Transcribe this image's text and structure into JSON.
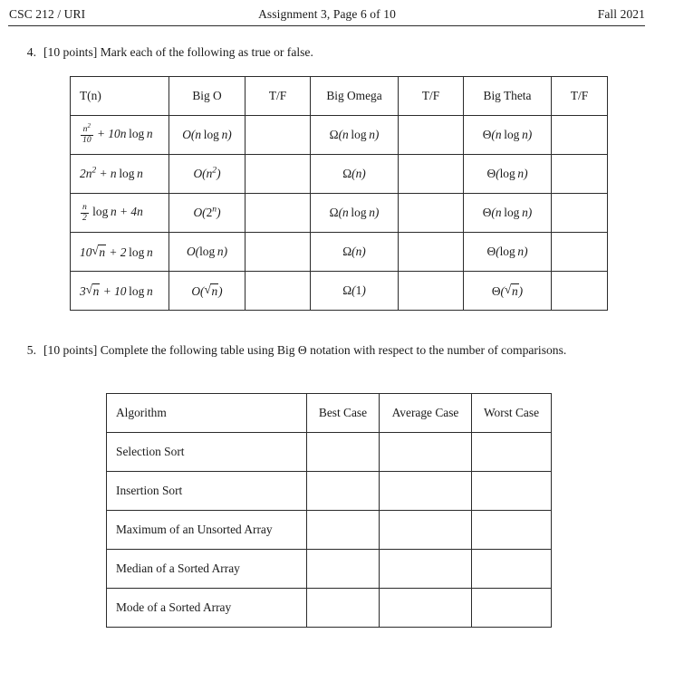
{
  "header": {
    "left": "CSC 212 / URI",
    "center": "Assignment 3, Page 6 of 10",
    "right": "Fall 2021"
  },
  "problems": [
    {
      "number": "4.",
      "points": "[10 points]",
      "text": "Mark each of the following as true or false."
    },
    {
      "number": "5.",
      "points": "[10 points]",
      "text": "Complete the following table using Big Θ notation with respect to the number of comparisons."
    }
  ],
  "table_truefalse": {
    "headers": [
      "T(n)",
      "Big O",
      "T/F",
      "Big Omega",
      "T/F",
      "Big Theta",
      "T/F"
    ],
    "rows": [
      {
        "tn": "n²/10 + 10n log n",
        "big_o": "O(n log n)",
        "tf1": "",
        "big_omega": "Ω(n log n)",
        "tf2": "",
        "big_theta": "Θ(n log n)",
        "tf3": ""
      },
      {
        "tn": "2n² + n log n",
        "big_o": "O(n²)",
        "tf1": "",
        "big_omega": "Ω(n)",
        "tf2": "",
        "big_theta": "Θ(log n)",
        "tf3": ""
      },
      {
        "tn": "n/2 log n + 4n",
        "big_o": "O(2ⁿ)",
        "tf1": "",
        "big_omega": "Ω(n log n)",
        "tf2": "",
        "big_theta": "Θ(n log n)",
        "tf3": ""
      },
      {
        "tn": "10√n + 2 log n",
        "big_o": "O(log n)",
        "tf1": "",
        "big_omega": "Ω(n)",
        "tf2": "",
        "big_theta": "Θ(log n)",
        "tf3": ""
      },
      {
        "tn": "3√n + 10 log n",
        "big_o": "O(√n)",
        "tf1": "",
        "big_omega": "Ω(1)",
        "tf2": "",
        "big_theta": "Θ(√n)",
        "tf3": ""
      }
    ]
  },
  "table_bigtheta": {
    "headers": [
      "Algorithm",
      "Best Case",
      "Average Case",
      "Worst Case"
    ],
    "rows": [
      {
        "algorithm": "Selection Sort",
        "best": "",
        "average": "",
        "worst": ""
      },
      {
        "algorithm": "Insertion Sort",
        "best": "",
        "average": "",
        "worst": ""
      },
      {
        "algorithm": "Maximum of an Unsorted Array",
        "best": "",
        "average": "",
        "worst": ""
      },
      {
        "algorithm": "Median of a Sorted Array",
        "best": "",
        "average": "",
        "worst": ""
      },
      {
        "algorithm": "Mode of a Sorted Array",
        "best": "",
        "average": "",
        "worst": ""
      }
    ]
  },
  "colors": {
    "text": "#1a1a1a",
    "rule": "#2b2b2b",
    "background": "#ffffff"
  }
}
